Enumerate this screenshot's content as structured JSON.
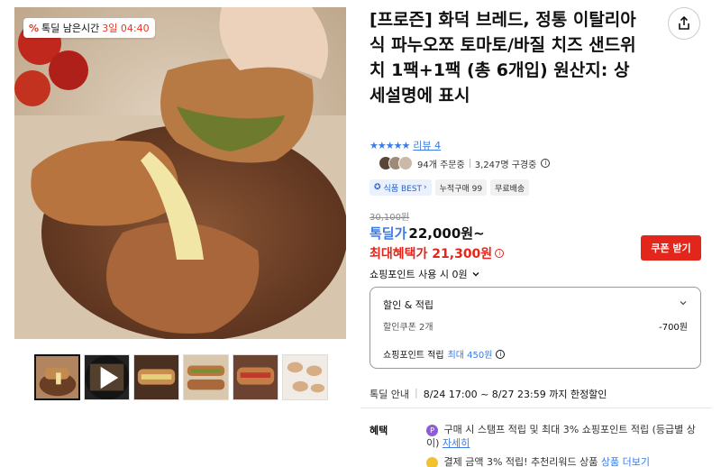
{
  "product": {
    "title": "[프로즌] 화덕 브레드, 정통 이탈리아식 파누오쪼 토마토/바질 치즈 샌드위치 1팩+1팩 (총 6개입) 원산지: 상세설명에 표시",
    "stars": "★★★★★",
    "review_label": "리뷰",
    "review_count": "4",
    "orders": "94개 주문중",
    "viewers": "3,247명 구경중",
    "tags": [
      "식품 BEST",
      "누적구매 99",
      "무료배송"
    ],
    "original_price": "30,100원",
    "deal_label": "톡딜가",
    "deal_price": "22,000원~",
    "max_benefit": "최대혜택가 21,300원",
    "coupon_button": "쿠폰 받기",
    "point_use": "쇼핑포인트 사용 시 0원",
    "timer_label": "톡딜 남은시간",
    "timer_value": "3일 04:40"
  },
  "discount_box": {
    "heading": "할인 & 적립",
    "coupon_label": "할인쿠폰 2개",
    "coupon_value": "-700원",
    "point_label": "쇼핑포인트 적립",
    "point_value": "최대 450원"
  },
  "deal": {
    "label": "톡딜 안내",
    "period": "8/24 17:00 ~ 8/27 23:59 까지 한정할인"
  },
  "benefits": {
    "label": "혜택",
    "line1": "구매 시 스탬프 적립 및 최대 3% 쇼핑포인트 적립 (등급별 상이)",
    "line1_link": "자세히",
    "line2": "결제 금액 3% 적립! 추천리워드 상품",
    "line2_link": "상품 더보기"
  },
  "colors": {
    "accent_blue": "#3a7be6",
    "accent_red": "#e3261b"
  }
}
